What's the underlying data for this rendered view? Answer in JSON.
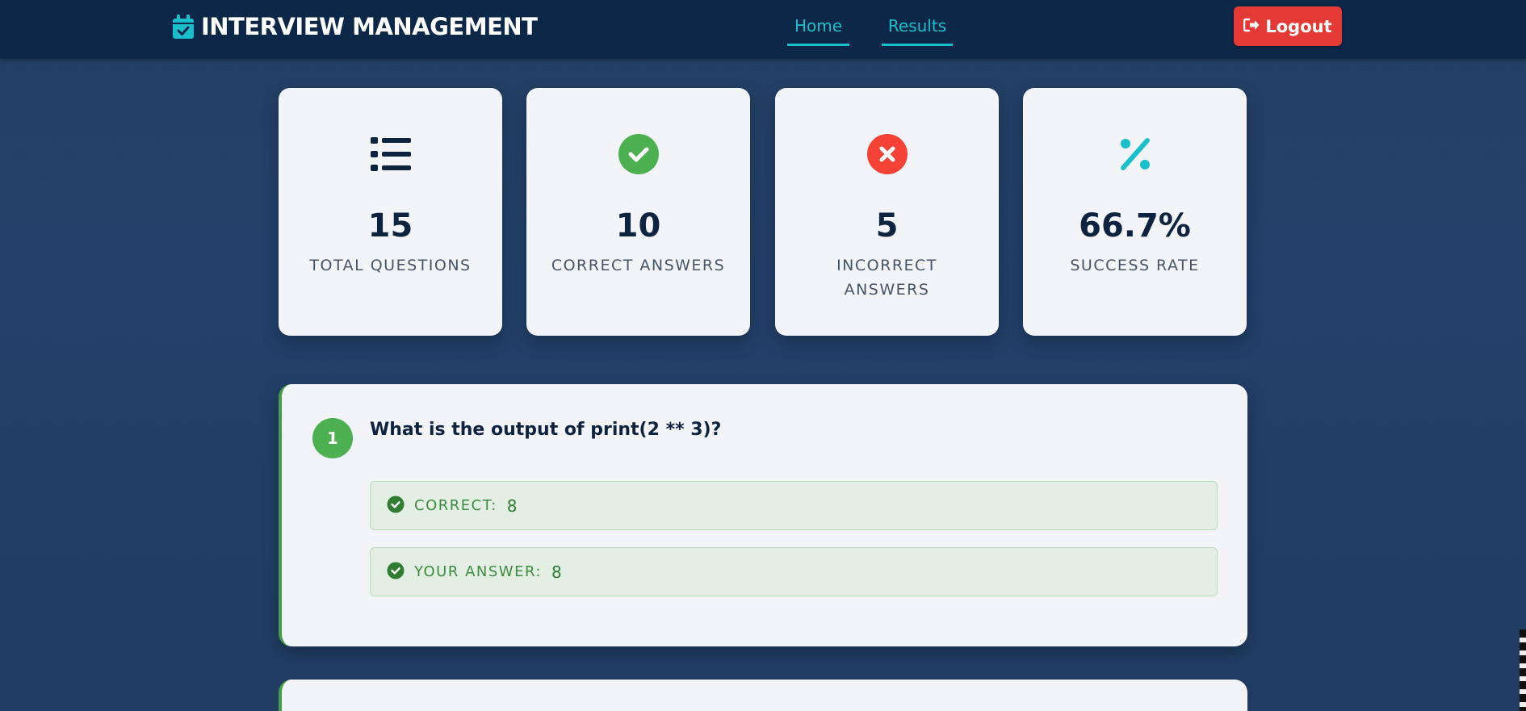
{
  "header": {
    "brand": "INTERVIEW MANAGEMENT",
    "nav": [
      {
        "label": "Home"
      },
      {
        "label": "Results"
      }
    ],
    "logout_label": "Logout"
  },
  "stats": [
    {
      "icon": "list-icon",
      "value": "15",
      "label": "TOTAL QUESTIONS",
      "color": "#0e2340"
    },
    {
      "icon": "check-circle-icon",
      "value": "10",
      "label": "CORRECT ANSWERS",
      "color": "#4caf50"
    },
    {
      "icon": "x-circle-icon",
      "value": "5",
      "label": "INCORRECT ANSWERS",
      "color": "#f44336"
    },
    {
      "icon": "percent-icon",
      "value": "66.7%",
      "label": "SUCCESS RATE",
      "color": "#19c0cc"
    }
  ],
  "questions": [
    {
      "number": "1",
      "text": "What is the output of print(2 ** 3)?",
      "correct_label": "CORRECT:",
      "correct_value": "8",
      "your_label": "YOUR ANSWER:",
      "your_value": "8"
    }
  ],
  "colors": {
    "accent": "#19c0cc",
    "success": "#4caf50",
    "danger": "#e53935",
    "navbar": "#0c2747"
  }
}
